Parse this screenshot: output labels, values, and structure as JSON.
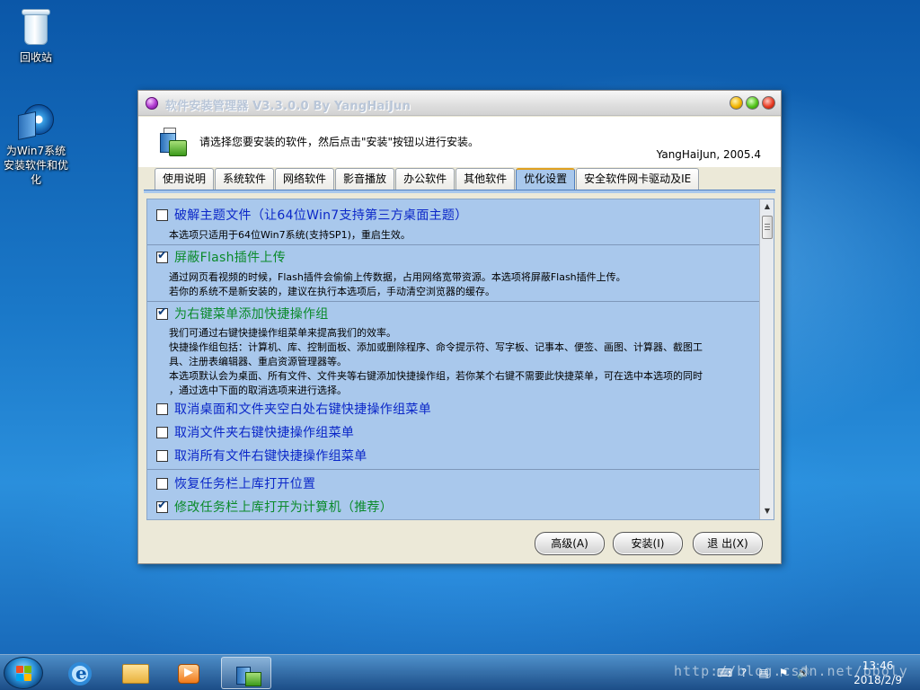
{
  "desktop": {
    "icons": [
      {
        "label": "回收站"
      },
      {
        "label": "为Win7系统安装软件和优化"
      }
    ]
  },
  "window": {
    "title": "软件安装管理器 V3.3.0.0 By YangHaiJun",
    "header": {
      "instruction": "请选择您要安装的软件，然后点击\"安装\"按钮以进行安装。",
      "author": "YangHaiJun, 2005.4"
    },
    "tabs": [
      "使用说明",
      "系统软件",
      "网络软件",
      "影音播放",
      "办公软件",
      "其他软件",
      "优化设置",
      "安全软件网卡驱动及IE"
    ],
    "active_tab": "优化设置",
    "options": [
      {
        "label": "破解主题文件（让64位Win7支持第三方桌面主题）",
        "checked": false,
        "desc": [
          "本选项只适用于64位Win7系统(支持SP1)，重启生效。"
        ]
      },
      {
        "label": "屏蔽Flash插件上传",
        "checked": true,
        "desc": [
          "通过网页看视频的时候，Flash插件会偷偷上传数据，占用网络宽带资源。本选项将屏蔽Flash插件上传。",
          "若你的系统不是新安装的，建议在执行本选项后，手动清空浏览器的缓存。"
        ]
      },
      {
        "label": "为右键菜单添加快捷操作组",
        "checked": true,
        "desc": [
          "我们可通过右键快捷操作组菜单来提高我们的效率。",
          "快捷操作组包括：计算机、库、控制面板、添加或删除程序、命令提示符、写字板、记事本、便签、画图、计算器、截图工",
          "具、注册表编辑器、重启资源管理器等。",
          "本选项默认会为桌面、所有文件、文件夹等右键添加快捷操作组，若你某个右键不需要此快捷菜单，可在选中本选项的同时",
          "，通过选中下面的取消选项来进行选择。"
        ]
      },
      {
        "label": "取消桌面和文件夹空白处右键快捷操作组菜单",
        "checked": false,
        "desc": []
      },
      {
        "label": "取消文件夹右键快捷操作组菜单",
        "checked": false,
        "desc": []
      },
      {
        "label": "取消所有文件右键快捷操作组菜单",
        "checked": false,
        "desc": []
      },
      {
        "label": "恢复任务栏上库打开位置",
        "checked": false,
        "desc": []
      },
      {
        "label": "修改任务栏上库打开为计算机（推荐）",
        "checked": true,
        "desc": []
      }
    ],
    "buttons": {
      "advanced": "高级(A)",
      "install": "安装(I)",
      "exit": "退 出(X)"
    }
  },
  "taskbar": {
    "time": "13:46",
    "date": "2018/2/9",
    "watermark": "http://blog.csdn.net/bboly"
  },
  "colors": {
    "option_unchecked": "#0b27c8",
    "option_checked": "#0a8a2a",
    "content_bg": "#a9c8ec"
  }
}
